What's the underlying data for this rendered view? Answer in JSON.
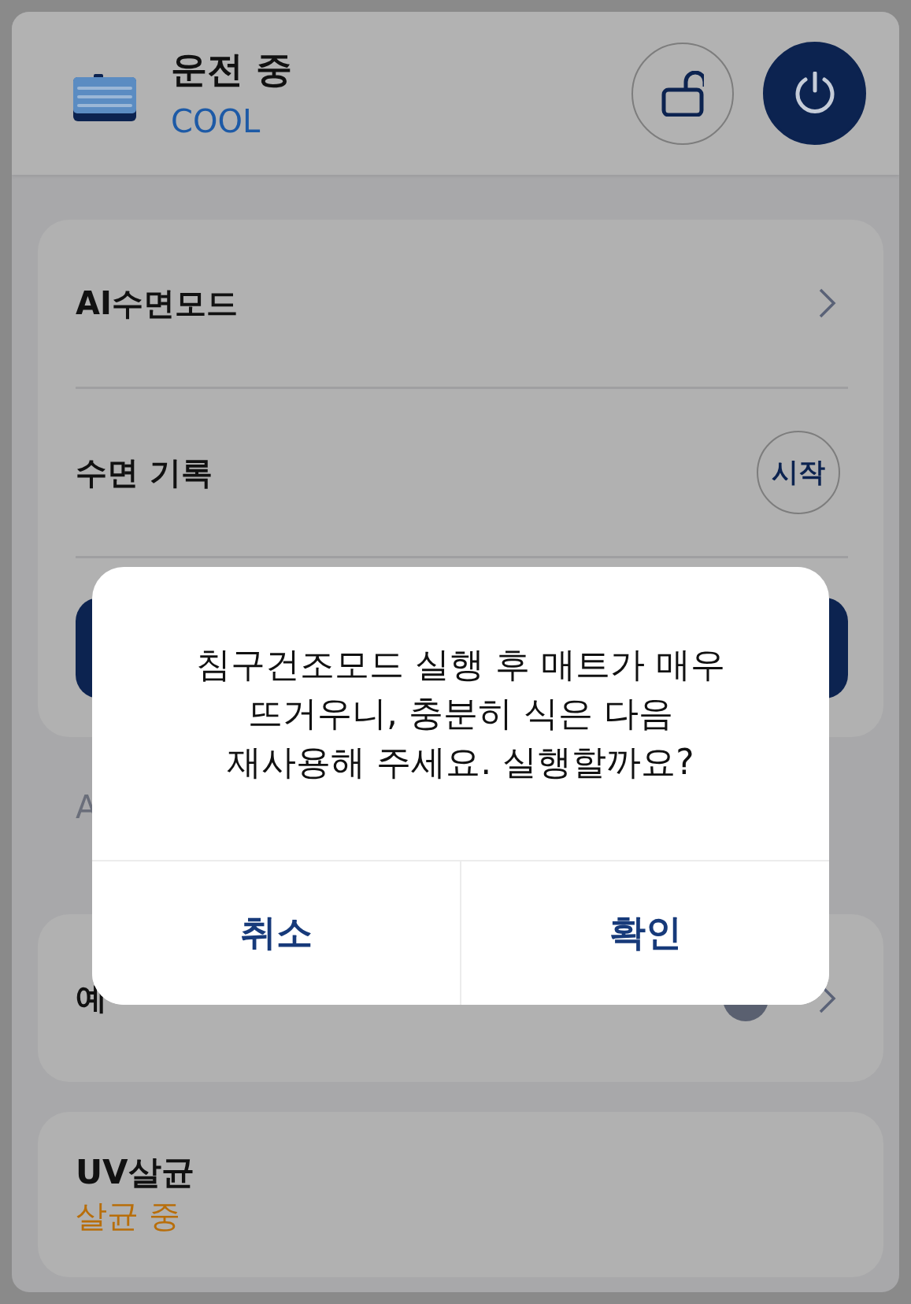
{
  "header": {
    "status": "운전 중",
    "mode": "COOL",
    "locked": false,
    "power_on": true
  },
  "sleep_card": {
    "rows": [
      {
        "kind": "link",
        "label": "AI수면모드"
      },
      {
        "kind": "action",
        "label": "수면 기록",
        "button": "시작"
      }
    ],
    "note": "A"
  },
  "reservation": {
    "label": "예"
  },
  "uv": {
    "title": "UV살균",
    "status": "살균 중"
  },
  "dialog": {
    "message": "침구건조모드 실행 후 매트가 매우 뜨거우니, 충분히 식은 다음 재사용해 주세요. 실행할까요?",
    "buttons": [
      "취소",
      "확인"
    ]
  }
}
